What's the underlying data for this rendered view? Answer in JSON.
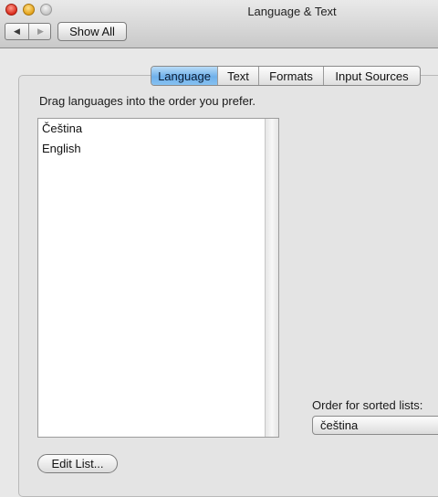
{
  "window": {
    "title": "Language & Text"
  },
  "toolbar": {
    "back_icon": "◀",
    "forward_icon": "▶",
    "show_all_label": "Show All"
  },
  "tabs": [
    {
      "label": "Language",
      "active": true
    },
    {
      "label": "Text",
      "active": false
    },
    {
      "label": "Formats",
      "active": false
    },
    {
      "label": "Input Sources",
      "active": false
    }
  ],
  "language_pane": {
    "instructions": "Drag languages into the order you prefer.",
    "languages": [
      "Čeština",
      "English"
    ],
    "edit_list_label": "Edit List...",
    "sort_label": "Order for sorted lists:",
    "sort_value": "čeština"
  },
  "colors": {
    "active_tab": "#6fb0ea",
    "close": "#d92b1c",
    "minimize": "#e3a21a"
  }
}
